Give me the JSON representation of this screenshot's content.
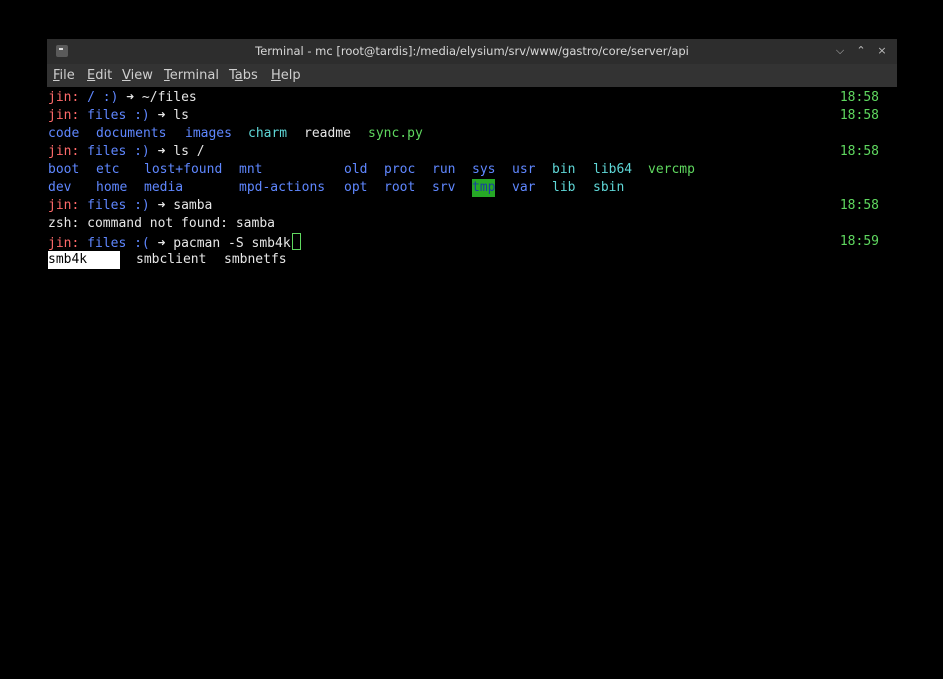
{
  "window": {
    "title": "Terminal - mc [root@tardis]:/media/elysium/srv/www/gastro/core/server/api",
    "buttons": {
      "minimize": "⌵",
      "maximize": "⌃",
      "close": "×"
    }
  },
  "menu": [
    "File",
    "Edit",
    "View",
    "Terminal",
    "Tabs",
    "Help"
  ],
  "terminal": {
    "l1": {
      "user": "jin:",
      "path": " / :)",
      "cmd": " ➜ ~/files",
      "time": "18:58"
    },
    "l2": {
      "user": "jin:",
      "path": " files :)",
      "cmd": " ➜ ls",
      "time": "18:58"
    },
    "l3": {
      "code": "code",
      "documents": "documents",
      "images": "images",
      "charm": "charm",
      "readme": "readme",
      "sync": "sync.py"
    },
    "l4": {
      "user": "jin:",
      "path": " files :)",
      "cmd": " ➜ ls /",
      "time": "18:58"
    },
    "l5": [
      "boot",
      "etc",
      "lost+found",
      "mnt",
      "old",
      "proc",
      "run",
      "sys",
      "usr",
      "bin",
      "lib64",
      "vercmp"
    ],
    "l6": [
      "dev",
      "home",
      "media",
      "mpd-actions",
      "opt",
      "root",
      "srv",
      "tmp",
      "var",
      "lib",
      "sbin"
    ],
    "l7": {
      "user": "jin:",
      "path": " files :)",
      "cmd": " ➜ samba",
      "time": "18:58"
    },
    "l8": "zsh: command not found: samba",
    "l9": {
      "user": "jin:",
      "path": " files :(",
      "cmd": " ➜ pacman -S smb4k",
      "time": "18:59"
    },
    "l10": {
      "sel": "smb4k",
      "a": "smbclient",
      "b": "smbnetfs"
    }
  },
  "colors": {
    "prompt_user": "#ff6a6a",
    "dir": "#5f87ff",
    "time": "#5fd75f"
  }
}
